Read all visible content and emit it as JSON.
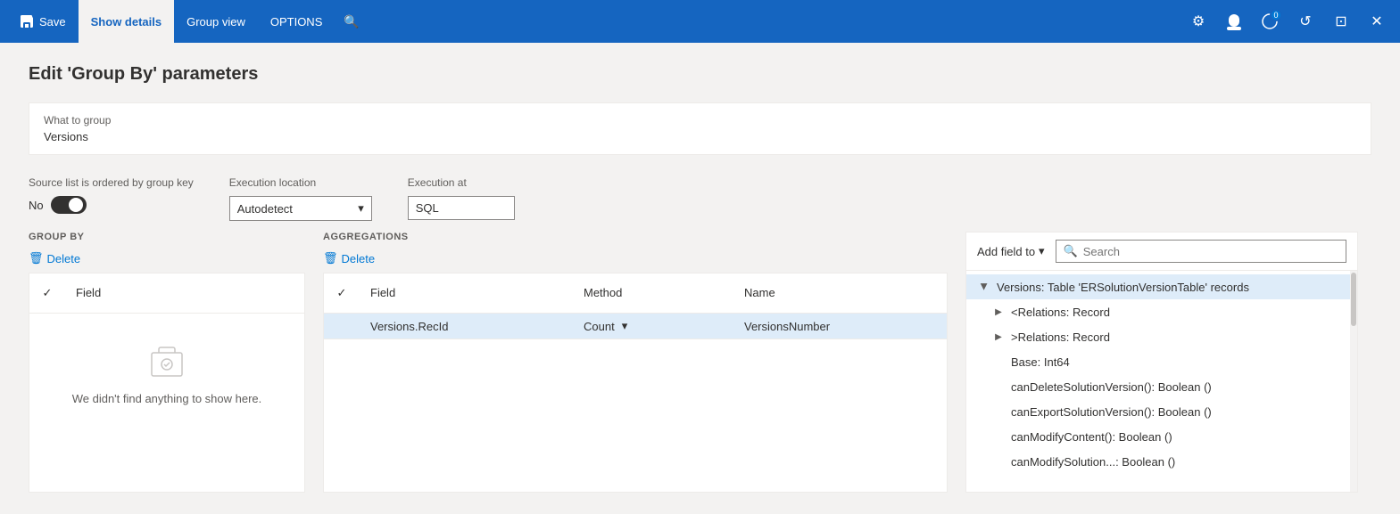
{
  "titlebar": {
    "save_label": "Save",
    "show_details_label": "Show details",
    "group_view_label": "Group view",
    "options_label": "OPTIONS"
  },
  "page": {
    "title": "Edit 'Group By' parameters"
  },
  "form": {
    "what_to_group_label": "What to group",
    "what_to_group_value": "Versions",
    "source_ordered_label": "Source list is ordered by group key",
    "source_ordered_value": "No",
    "execution_location_label": "Execution location",
    "execution_location_value": "Autodetect",
    "execution_at_label": "Execution at",
    "execution_at_value": "SQL"
  },
  "group_by": {
    "header": "GROUP BY",
    "delete_label": "Delete",
    "col_field": "Field",
    "empty_text": "We didn't find anything to show here."
  },
  "aggregations": {
    "header": "AGGREGATIONS",
    "delete_label": "Delete",
    "col_field": "Field",
    "col_method": "Method",
    "col_name": "Name",
    "rows": [
      {
        "field": "Versions.RecId",
        "method": "Count",
        "name": "VersionsNumber"
      }
    ]
  },
  "right_panel": {
    "add_field_label": "Add field to",
    "search_placeholder": "Search",
    "tree": [
      {
        "level": 1,
        "label": "Versions: Table 'ERSolutionVersionTable' records",
        "expanded": true,
        "selected": true,
        "has_expand": true
      },
      {
        "level": 2,
        "label": "<Relations: Record",
        "has_expand": true
      },
      {
        "level": 2,
        "label": ">Relations: Record",
        "has_expand": true
      },
      {
        "level": 2,
        "label": "Base: Int64",
        "has_expand": false
      },
      {
        "level": 2,
        "label": "canDeleteSolutionVersion(): Boolean ()",
        "has_expand": false
      },
      {
        "level": 2,
        "label": "canExportSolutionVersion(): Boolean ()",
        "has_expand": false
      },
      {
        "level": 2,
        "label": "canModifyContent(): Boolean ()",
        "has_expand": false
      },
      {
        "level": 2,
        "label": "canModifySolution...: Boolean ()",
        "has_expand": false
      }
    ]
  }
}
